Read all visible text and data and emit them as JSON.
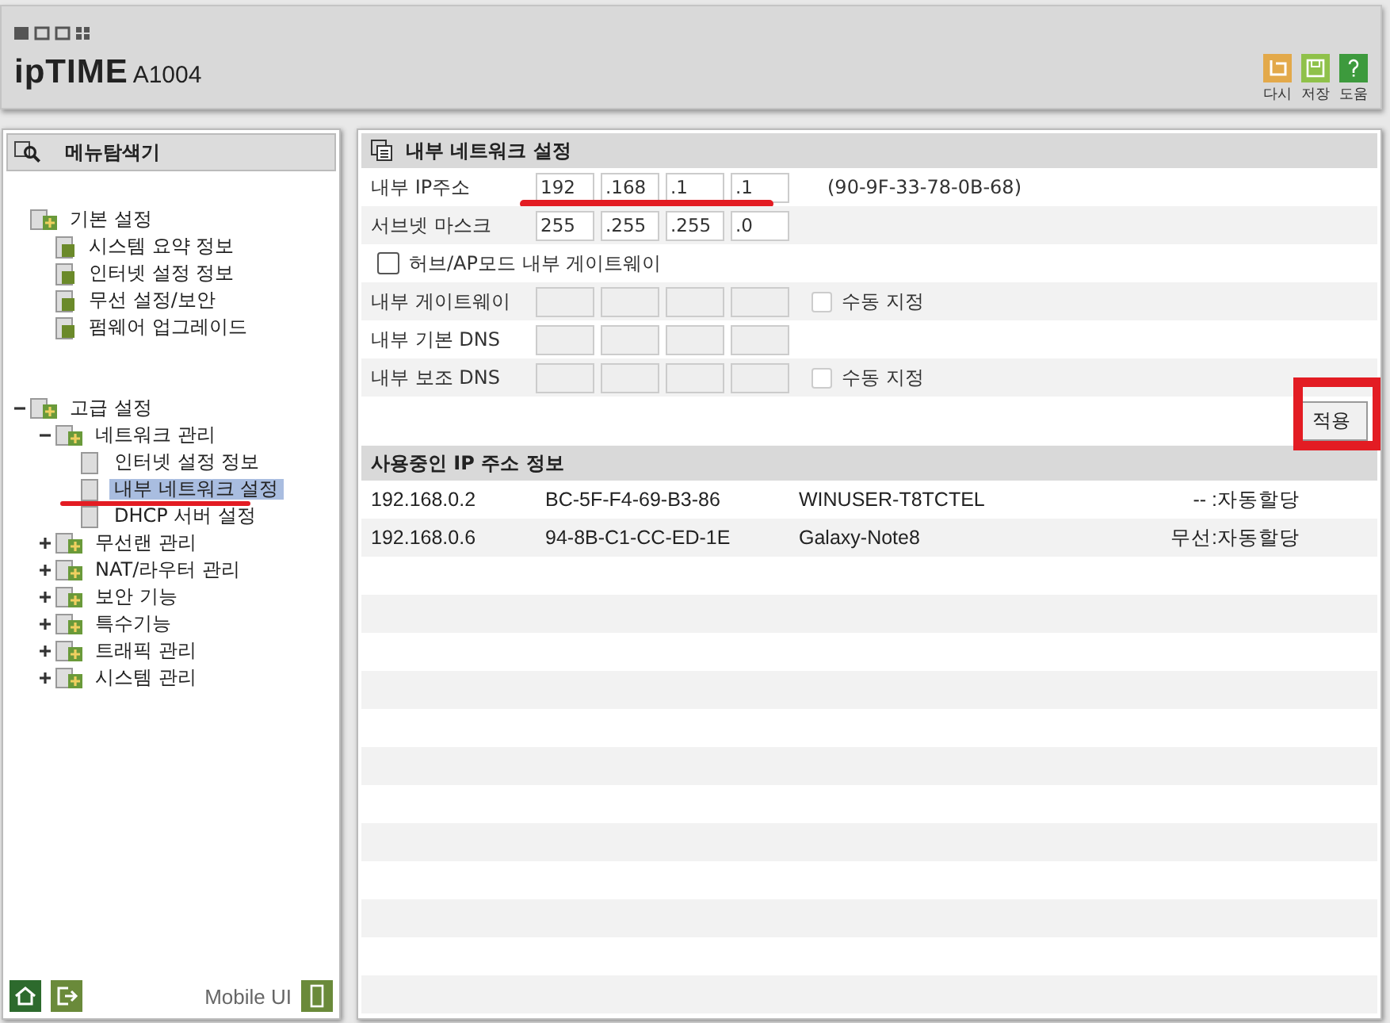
{
  "header": {
    "logo": {
      "brand": "ipTIME",
      "model": "A1004"
    },
    "actions": [
      {
        "kind": "undo",
        "label": "다시"
      },
      {
        "kind": "save",
        "label": "저장"
      },
      {
        "kind": "help",
        "label": "도움"
      }
    ]
  },
  "sidebar": {
    "title": "메뉴탐색기",
    "tree": [
      {
        "label": "기본 설정",
        "selected": false,
        "children": [
          {
            "label": "시스템 요약 정보",
            "selected": false
          },
          {
            "label": "인터넷 설정 정보",
            "selected": false
          },
          {
            "label": "무선 설정/보안",
            "selected": false
          },
          {
            "label": "펌웨어 업그레이드",
            "selected": false
          }
        ]
      },
      {
        "label": "고급 설정",
        "selected": false,
        "expanded": true,
        "children": [
          {
            "label": "네트워크 관리",
            "selected": false,
            "expanded": true,
            "children": [
              {
                "label": "인터넷 설정 정보",
                "selected": false
              },
              {
                "label": "내부 네트워크 설정",
                "selected": true
              },
              {
                "label": "DHCP 서버 설정",
                "selected": false
              }
            ]
          },
          {
            "label": "무선랜 관리",
            "selected": false,
            "expanded": false
          },
          {
            "label": "NAT/라우터 관리",
            "selected": false,
            "expanded": false
          },
          {
            "label": "보안 기능",
            "selected": false,
            "expanded": false
          },
          {
            "label": "특수기능",
            "selected": false,
            "expanded": false
          },
          {
            "label": "트래픽 관리",
            "selected": false,
            "expanded": false
          },
          {
            "label": "시스템 관리",
            "selected": false,
            "expanded": false
          }
        ]
      }
    ],
    "footer": {
      "mobile_label": "Mobile UI"
    }
  },
  "settings": {
    "title": "내부 네트워크 설정",
    "rows": [
      {
        "kind": "ip",
        "label": "내부 IP주소",
        "disabled": false,
        "octets": [
          "192",
          ".168",
          ".1",
          ".1"
        ],
        "note": "(90-9F-33-78-0B-68)"
      },
      {
        "kind": "ip",
        "label": "서브넷 마스크",
        "disabled": false,
        "octets": [
          "255",
          ".255",
          ".255",
          ".0"
        ]
      },
      {
        "kind": "checkbox",
        "label": "허브/AP모드 내부 게이트웨이",
        "checked": false
      },
      {
        "kind": "ip",
        "label": "내부 게이트웨이",
        "disabled": true,
        "manual": {
          "label": "수동 지정",
          "checked": false
        }
      },
      {
        "kind": "ip",
        "label": "내부 기본 DNS",
        "disabled": true
      },
      {
        "kind": "ip",
        "label": "내부 보조 DNS",
        "disabled": true,
        "manual": {
          "label": "수동 지정",
          "checked": false
        }
      }
    ],
    "apply_button": "적용"
  },
  "clients": {
    "title": "사용중인 IP 주소 정보",
    "rows": [
      {
        "ip": "192.168.0.2",
        "mac": "BC-5F-F4-69-B3-86",
        "name": "WINUSER-T8TCTEL",
        "type": "-- :자동할당"
      },
      {
        "ip": "192.168.0.6",
        "mac": "94-8B-C1-CC-ED-1E",
        "name": "Galaxy-Note8",
        "type": "무선:자동할당"
      }
    ]
  }
}
